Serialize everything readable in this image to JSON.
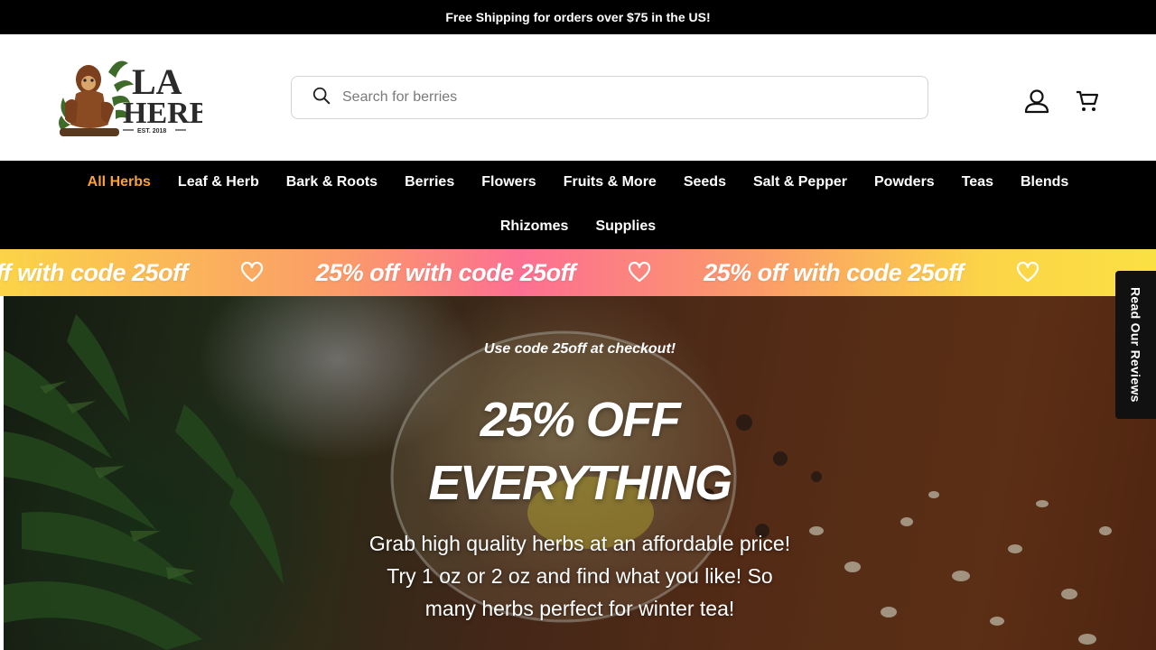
{
  "announcement": "Free Shipping for orders over $75 in the US!",
  "logo": {
    "line1": "LA",
    "line2": "HERB",
    "tagline": "EST. 2018"
  },
  "search": {
    "placeholder": "Search for berries"
  },
  "header_icons": [
    "account-icon",
    "cart-icon"
  ],
  "nav": {
    "row1": [
      "All Herbs",
      "Leaf & Herb",
      "Bark & Roots",
      "Berries",
      "Flowers",
      "Fruits & More",
      "Seeds",
      "Salt & Pepper",
      "Powders",
      "Teas",
      "Blends"
    ],
    "row2": [
      "Rhizomes",
      "Supplies"
    ],
    "active": "All Herbs"
  },
  "marquee": {
    "text": "25% off with code 25off",
    "icon": "heart-icon"
  },
  "hero": {
    "kicker": "Use code 25off at checkout!",
    "title_line1": "25% OFF",
    "title_line2": "EVERYTHING",
    "description": "Grab high quality herbs at an affordable price! Try 1 oz or 2 oz and find what you like! So many herbs perfect for winter tea!"
  },
  "reviews_tab": "Read Our Reviews",
  "colors": {
    "accent": "#f7a337",
    "nav_bg": "#000000",
    "marquee_yellow": "#fbd447",
    "marquee_pink": "#fc6f92"
  }
}
